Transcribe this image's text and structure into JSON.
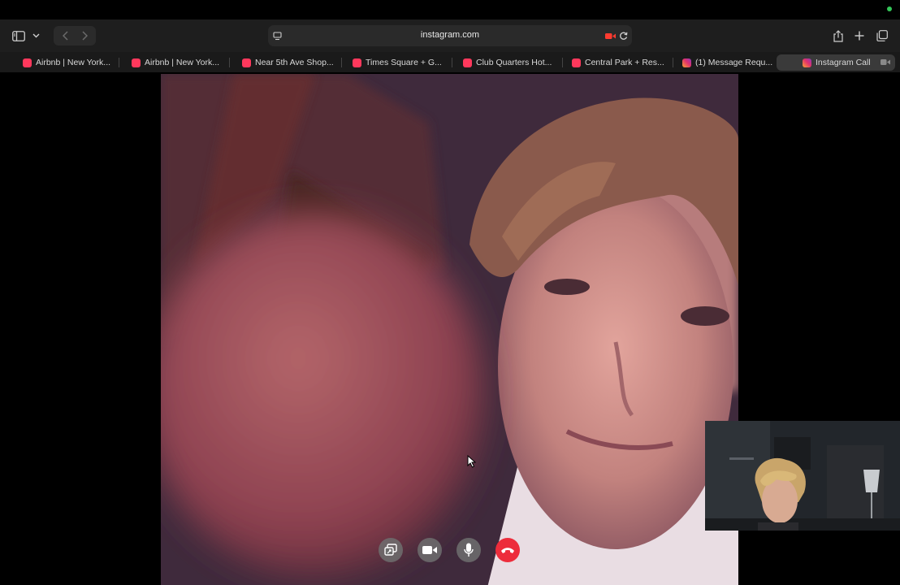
{
  "browser": {
    "url": "instagram.com",
    "tabs": [
      {
        "label": "Airbnb | New York...",
        "favicon": "airbnb-icon"
      },
      {
        "label": "Airbnb | New York...",
        "favicon": "airbnb-icon"
      },
      {
        "label": "Near 5th Ave Shop...",
        "favicon": "airbnb-icon"
      },
      {
        "label": "Times Square + G...",
        "favicon": "airbnb-icon"
      },
      {
        "label": "Club Quarters Hot...",
        "favicon": "airbnb-icon"
      },
      {
        "label": "Central Park + Res...",
        "favicon": "airbnb-icon"
      },
      {
        "label": "(1) Message Requ...",
        "favicon": "instagram-icon"
      },
      {
        "label": "Instagram Call",
        "favicon": "instagram-icon",
        "active": true
      }
    ]
  },
  "call": {
    "controls": [
      "share-screen",
      "camera",
      "microphone",
      "end-call"
    ],
    "colors": {
      "end_call": "#ed2c3b",
      "camera_indicator": "#ff3b30",
      "active_dot": "#34c759"
    }
  }
}
